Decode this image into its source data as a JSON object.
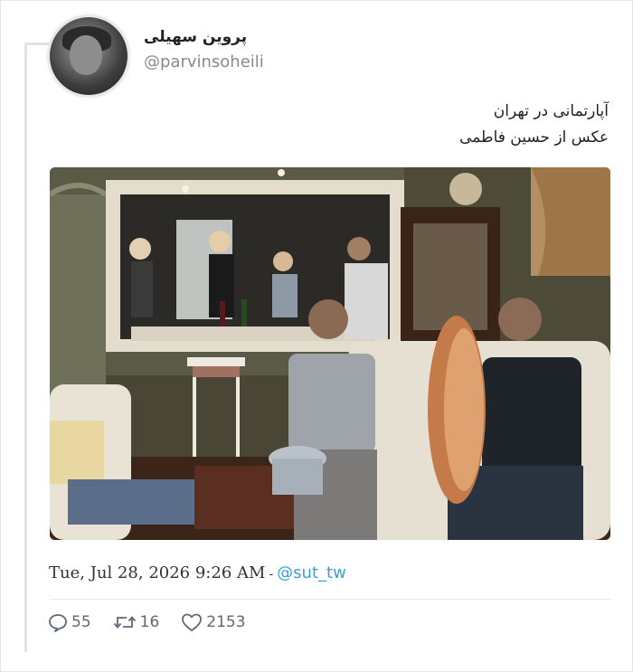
{
  "tweet": {
    "display_name": "پروین سهیلی",
    "handle": "@parvinsoheili",
    "text_lines": [
      "آپارتمانی در تهران",
      "عکس از حسین فاطمی"
    ],
    "timestamp": "Tue, Jul 28, 2026 9:26 AM",
    "separator": "-",
    "via_handle": "@sut_tw",
    "photo": {
      "subject": "people in an apartment living room, one laughing behind a frame drum, one playing a drum, women at a kitchen window"
    }
  },
  "actions": {
    "replies": "55",
    "retweets": "16",
    "likes": "2153"
  },
  "colors": {
    "link": "#3aa0d8",
    "muted": "#8a8a8a",
    "rail": "#e3e3e3"
  },
  "icons": [
    "reply-icon",
    "retweet-icon",
    "heart-icon"
  ]
}
